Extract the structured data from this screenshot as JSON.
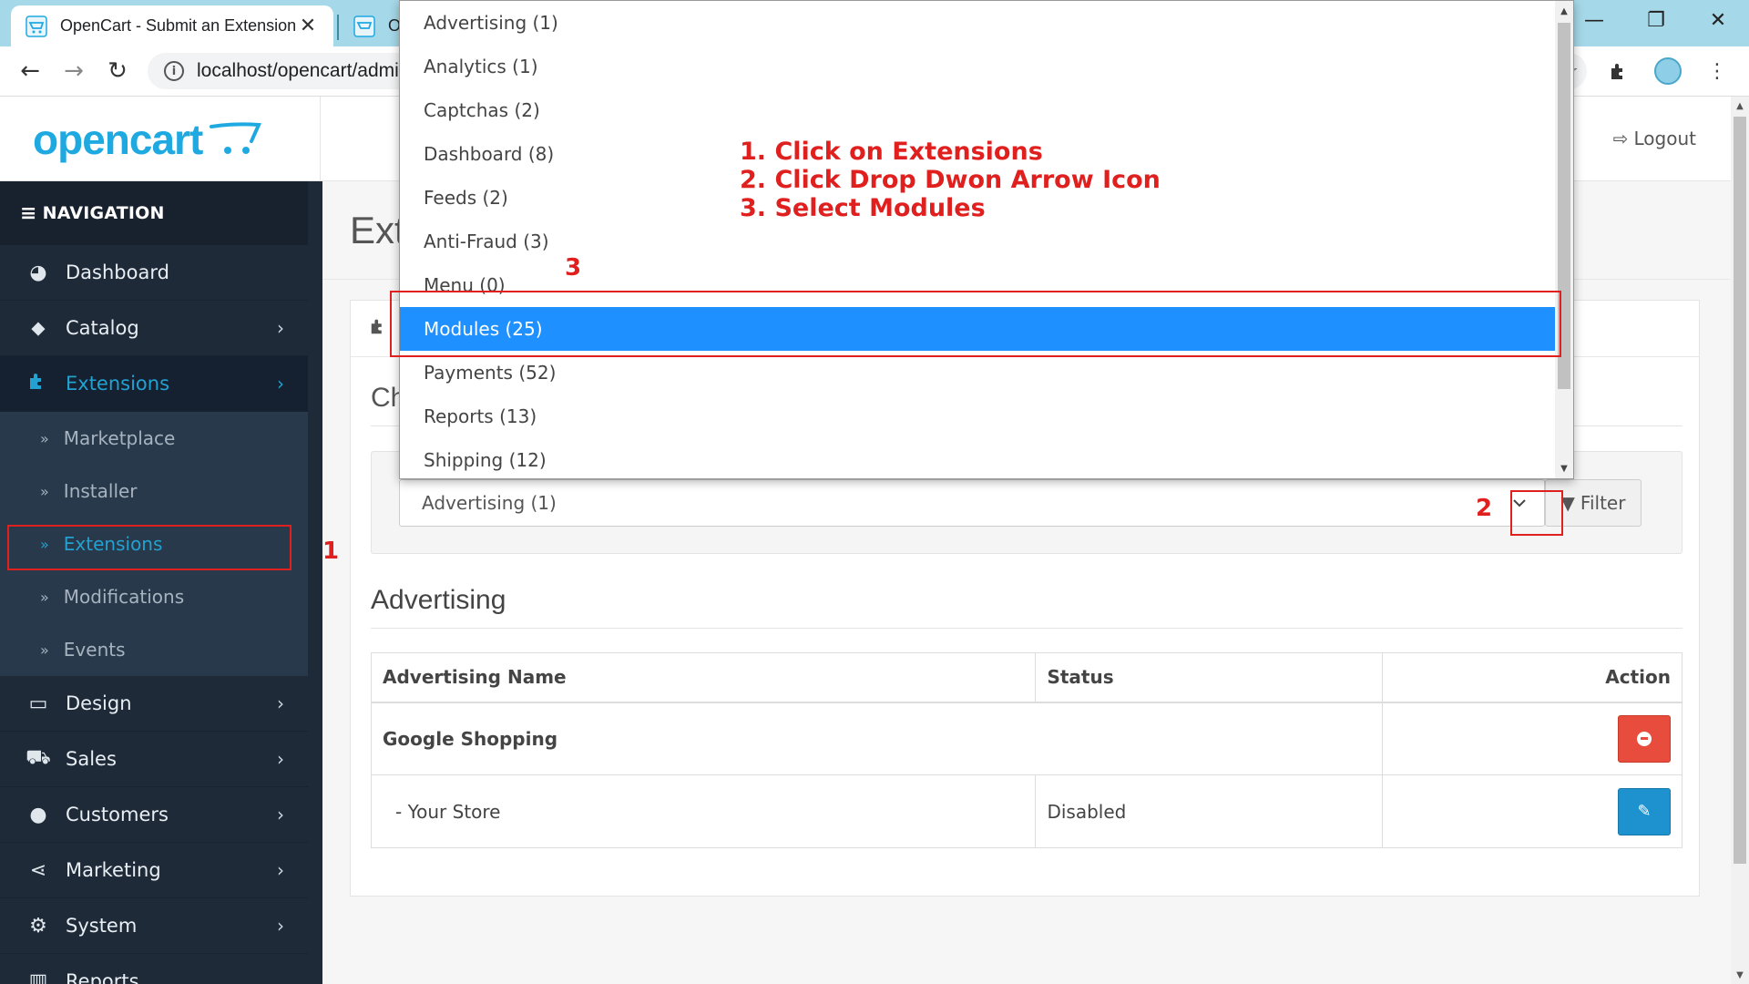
{
  "browser": {
    "tabs": [
      {
        "title": "OpenCart - Submit an Extension",
        "close": "✕"
      },
      {
        "title": "O",
        "close": ""
      }
    ],
    "url": "localhost/opencart/admi",
    "window_controls": {
      "minimize": "—",
      "restore": "❐",
      "close": "✕"
    }
  },
  "header": {
    "logo": "opencart",
    "logout_label": "Logout"
  },
  "sidebar": {
    "nav_label": "NAVIGATION",
    "items": [
      {
        "label": "Dashboard",
        "icon": "dashboard-icon",
        "has_children": false
      },
      {
        "label": "Catalog",
        "icon": "tags-icon",
        "has_children": true
      },
      {
        "label": "Extensions",
        "icon": "puzzle-icon",
        "has_children": true,
        "active": true
      },
      {
        "label": "Design",
        "icon": "monitor-icon",
        "has_children": true
      },
      {
        "label": "Sales",
        "icon": "cart-icon",
        "has_children": true
      },
      {
        "label": "Customers",
        "icon": "user-icon",
        "has_children": true
      },
      {
        "label": "Marketing",
        "icon": "share-icon",
        "has_children": true
      },
      {
        "label": "System",
        "icon": "gear-icon",
        "has_children": true
      },
      {
        "label": "Reports",
        "icon": "bar-chart-icon",
        "has_children": false
      }
    ],
    "extensions_submenu": [
      {
        "label": "Marketplace"
      },
      {
        "label": "Installer"
      },
      {
        "label": "Extensions",
        "active": true
      },
      {
        "label": "Modifications"
      },
      {
        "label": "Events"
      }
    ]
  },
  "main": {
    "page_title": "Ext",
    "panel_heading": "",
    "choose_label": "Ch",
    "select_value": "Advertising (1)",
    "filter_label": "Filter",
    "section_title": "Advertising",
    "table": {
      "headers": [
        "Advertising Name",
        "Status",
        "Action"
      ],
      "rows": [
        {
          "name": "Google Shopping",
          "status": "",
          "action": "uninstall"
        },
        {
          "name": "-   Your Store",
          "status": "Disabled",
          "action": "edit"
        }
      ]
    }
  },
  "dropdown": {
    "options": [
      "Advertising (1)",
      "Analytics (1)",
      "Captchas (2)",
      "Dashboard (8)",
      "Feeds (2)",
      "Anti-Fraud (3)",
      "Menu (0)",
      "Modules (25)",
      "Payments (52)",
      "Reports (13)",
      "Shipping (12)"
    ],
    "selected": "Modules (25)"
  },
  "annotations": {
    "steps": [
      "1. Click on Extensions",
      "2. Click Drop Dwon Arrow Icon",
      "3. Select Modules"
    ],
    "marker_1": "1",
    "marker_2": "2",
    "marker_3": "3"
  },
  "colors": {
    "accent": "#23a1d1",
    "sidebar_bg": "#1e2a38",
    "selected_option": "#1e90ff",
    "annotation_red": "#e0201f",
    "danger": "#e74c3c",
    "primary": "#1e91cf"
  }
}
